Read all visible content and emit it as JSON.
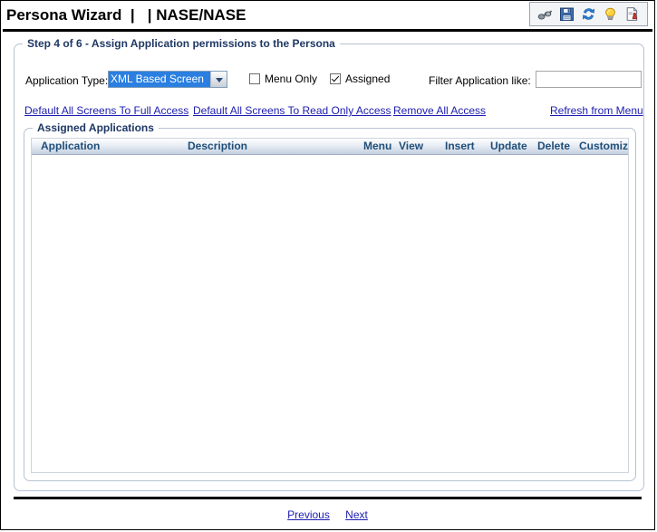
{
  "window": {
    "title": "Persona Wizard  |   | NASE/NASE"
  },
  "toolbar": {
    "icons": [
      {
        "name": "binoculars-icon",
        "label": "Find"
      },
      {
        "name": "save-icon",
        "label": "Save"
      },
      {
        "name": "refresh-icon",
        "label": "Refresh"
      },
      {
        "name": "lightbulb-icon",
        "label": "Hint"
      },
      {
        "name": "document-export-icon",
        "label": "Report"
      }
    ]
  },
  "step_panel": {
    "legend": "Step 4 of 6 - Assign Application permissions to the Persona",
    "application_type": {
      "label": "Application Type:",
      "selected": "XML Based Screen"
    },
    "menu_only": {
      "label": "Menu Only",
      "checked": false
    },
    "assigned": {
      "label": "Assigned",
      "checked": true
    },
    "filter": {
      "label": "Filter Application like:",
      "value": "",
      "placeholder": ""
    },
    "links": {
      "full_access": "Default All Screens To Full Access",
      "read_only_access": "Default All Screens To Read Only Access",
      "remove_all_access": "Remove All Access",
      "refresh_from_menu": "Refresh from Menu"
    }
  },
  "assigned_applications": {
    "legend": "Assigned Applications",
    "columns": [
      "Application",
      "Description",
      "Menu",
      "View",
      "Insert",
      "Update",
      "Delete",
      "Customiz"
    ],
    "rows": []
  },
  "footer": {
    "previous": "Previous",
    "next": "Next"
  },
  "colors": {
    "link": "#1c1cb0",
    "legend": "#1f3864",
    "grid_header_text": "#1f4e79",
    "combo_selection": "#2a7fe0"
  }
}
